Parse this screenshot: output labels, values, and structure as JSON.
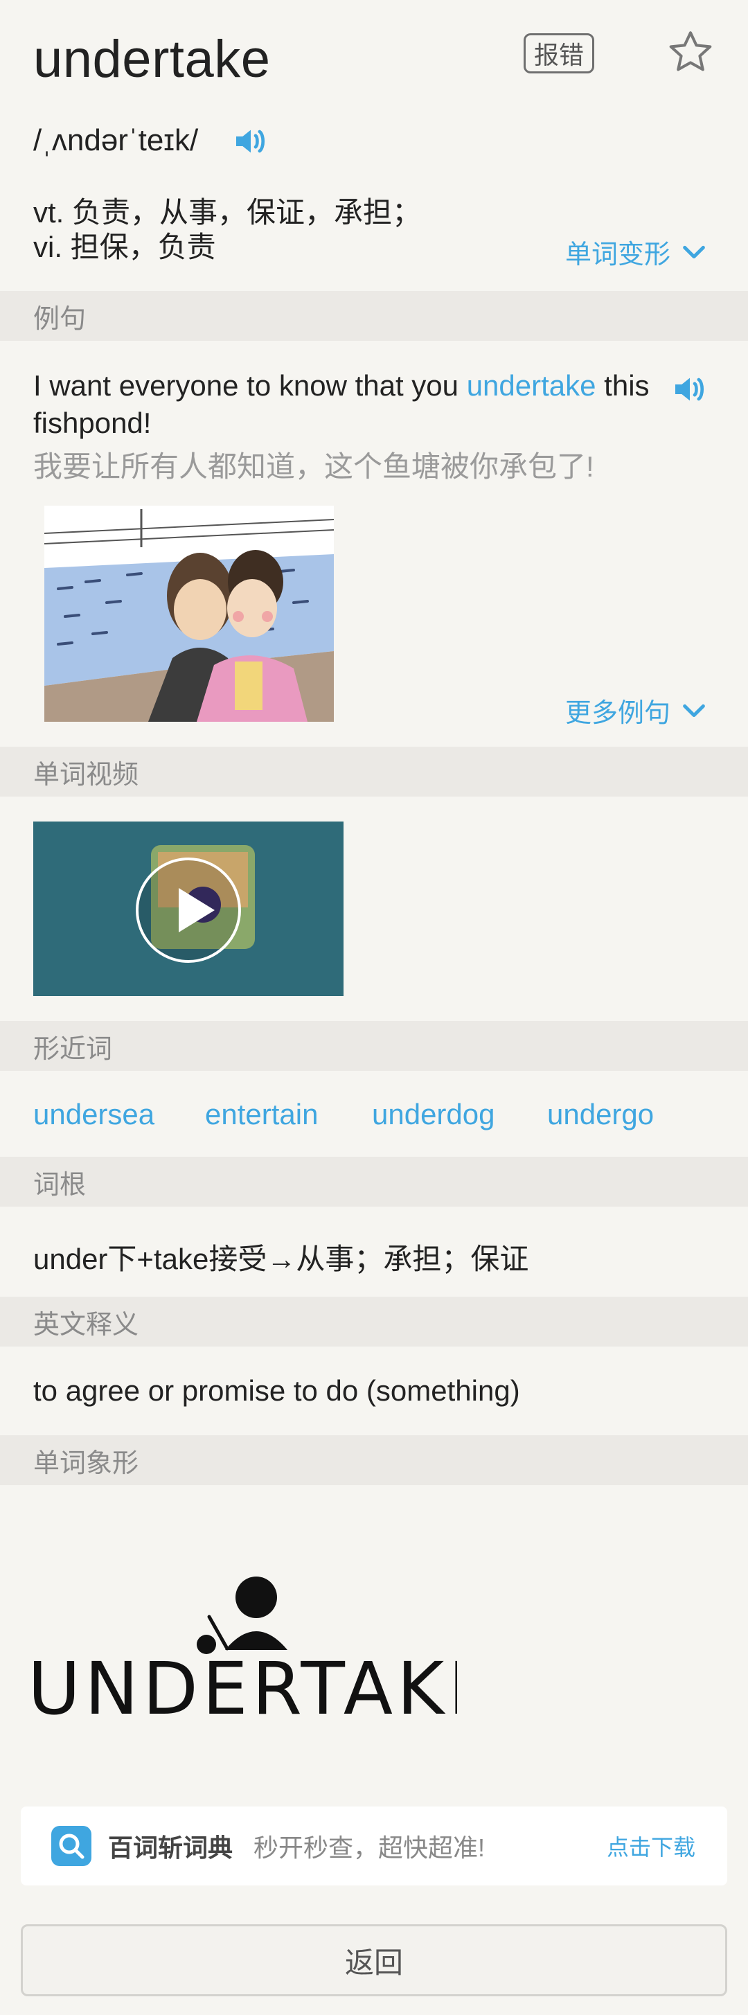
{
  "header": {
    "word": "undertake",
    "report_label": "报错",
    "favorite_icon": "star-icon",
    "phonetic": "/ˌʌndərˈteɪk/",
    "definitions": [
      "vt. 负责，从事，保证，承担；",
      "vi. 担保，负责"
    ],
    "word_forms_label": "单词变形"
  },
  "sections": {
    "examples": "例句",
    "video": "单词视频",
    "similar": "形近词",
    "root": "词根",
    "english_def": "英文释义",
    "pictograph": "单词象形"
  },
  "example": {
    "en_before": "I want everyone to know that you ",
    "en_highlight": "undertake",
    "en_after": " this fishpond!",
    "cn": "我要让所有人都知道，这个鱼塘被你承包了!",
    "more_label": "更多例句"
  },
  "similar_words": [
    "undersea",
    "entertain",
    "underdog",
    "undergo"
  ],
  "root_text": "under下+take接受→从事；承担；保证",
  "english_definition": "to agree or promise to do (something)",
  "pictograph_word": "UNDERTAKE",
  "banner": {
    "app_name": "百词斩词典",
    "tagline": "秒开秒查，超快超准!",
    "download_label": "点击下载"
  },
  "back_label": "返回",
  "colors": {
    "accent": "#3fa6e0",
    "background": "#f6f5f1",
    "section_bg": "#ebe9e5"
  }
}
